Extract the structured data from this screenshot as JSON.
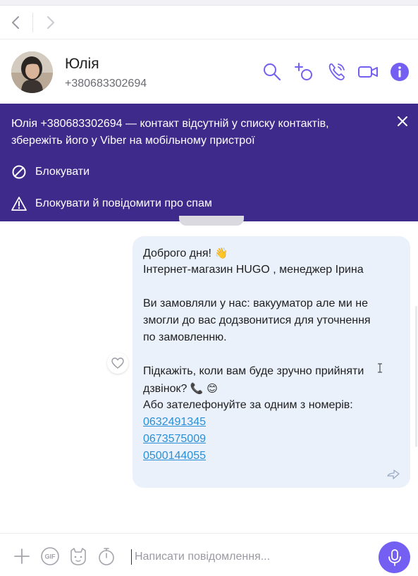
{
  "contact": {
    "name": "Юлія",
    "phone": "+380683302694"
  },
  "banner": {
    "line1": "Юлія +380683302694 — контакт відсутній у списку контактів,",
    "line2": "збережіть його у Viber на мобільному пристрої",
    "block_label": "Блокувати",
    "spam_label": "Блокувати й повідомити про спам"
  },
  "message": {
    "greeting": "Доброго дня!",
    "greeting_emoji": "👋",
    "line2": "Інтернет-магазин  HUGO  , менеджер Ірина",
    "line3": "Ви замовляли у нас: вакууматор   але ми не",
    "line4": "змогли до вас додзвонитися для уточнення",
    "line5": "по замовленню.",
    "line6": "Підкажіть, коли вам буде зручно прийняти",
    "line7": "дзвінок?",
    "line7_emoji": "📞 😊",
    "line8": "Або зателефонуйте за одним з номерів:",
    "phones": [
      "0632491345",
      "0673575009",
      "0500144055"
    ]
  },
  "composer": {
    "placeholder": "Написати повідомлення...",
    "gif_label": "GIF"
  },
  "colors": {
    "accent": "#7360f2",
    "banner_bg": "#3d2a8a",
    "bubble_bg": "#eaf1fb",
    "link": "#2a8fd6"
  },
  "icons": [
    "chevron-left-icon",
    "chevron-right-icon",
    "search-icon",
    "add-participant-icon",
    "phone-call-icon",
    "video-call-icon",
    "info-icon",
    "close-icon",
    "block-icon",
    "warning-icon",
    "heart-icon",
    "sent-icon",
    "plus-icon",
    "gif-icon",
    "sticker-icon",
    "timer-icon",
    "microphone-icon"
  ]
}
